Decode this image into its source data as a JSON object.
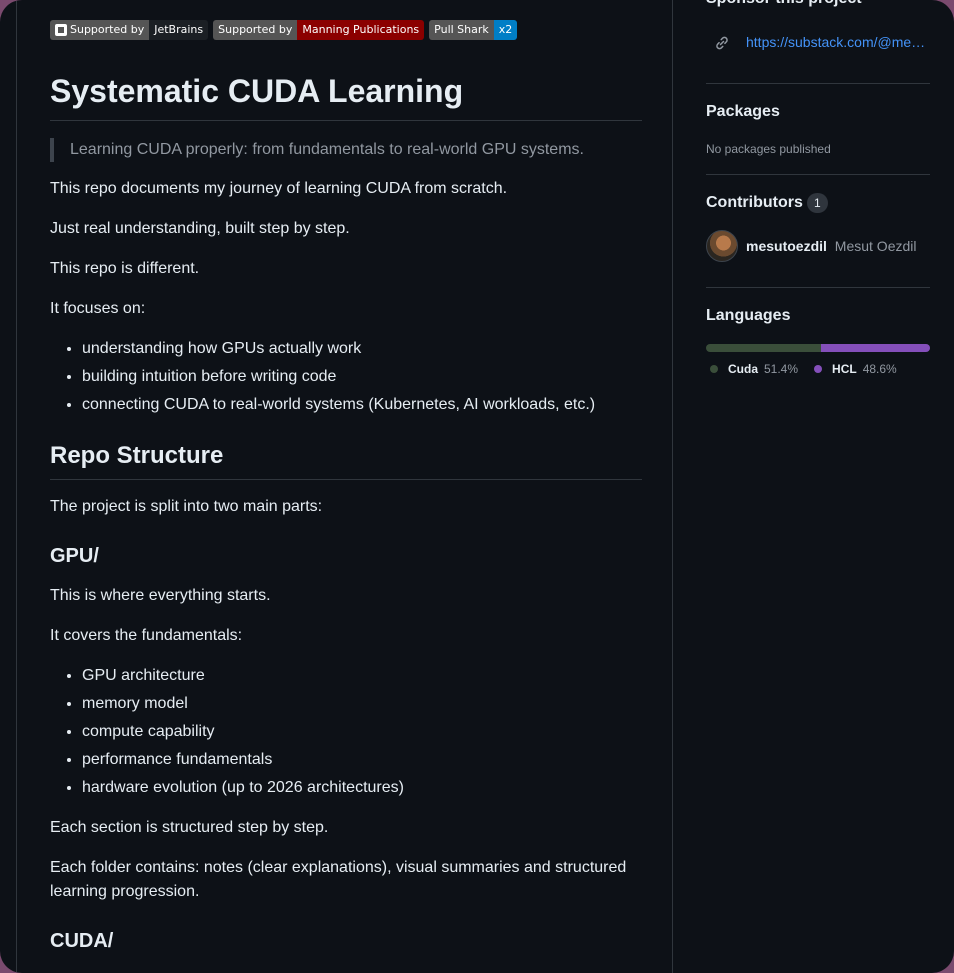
{
  "badges": [
    {
      "label": "Supported by",
      "value": "JetBrains",
      "icon": "jetbrains-icon"
    },
    {
      "label": "Supported by",
      "value": "Manning Publications"
    },
    {
      "label": "Pull Shark",
      "value": "x2"
    }
  ],
  "readme": {
    "title": "Systematic CUDA Learning",
    "quote": "Learning CUDA properly: from fundamentals to real-world GPU systems.",
    "p1": "This repo documents my journey of learning CUDA from scratch.",
    "p2": "Just real understanding, built step by step.",
    "p3": "This repo is different.",
    "p4": "It focuses on:",
    "focus": [
      "understanding how GPUs actually work",
      "building intuition before writing code",
      "connecting CUDA to real-world systems (Kubernetes, AI workloads, etc.)"
    ],
    "h_structure": "Repo Structure",
    "p5": "The project is split into two main parts:",
    "h_gpu": "GPU/",
    "p6": "This is where everything starts.",
    "p7": "It covers the fundamentals:",
    "fundamentals": [
      "GPU architecture",
      "memory model",
      "compute capability",
      "performance fundamentals",
      "hardware evolution (up to 2026 architectures)"
    ],
    "p8": "Each section is structured step by step.",
    "p9": "Each folder contains: notes (clear explanations), visual summaries and structured learning progression.",
    "h_cuda": "CUDA/"
  },
  "sidebar": {
    "sponsor_title": "Sponsor this project",
    "sponsor_link": "https://substack.com/@mesutoezdil",
    "packages_title": "Packages",
    "packages_text": "No packages published",
    "contributors_title": "Contributors",
    "contributors_count": "1",
    "contributor_login": "mesutoezdil",
    "contributor_name": "Mesut Oezdil",
    "languages_title": "Languages",
    "languages": [
      {
        "name": "Cuda",
        "percent": "51.4%",
        "value": 51.4,
        "color": "#3a4e3a"
      },
      {
        "name": "HCL",
        "percent": "48.6%",
        "value": 48.6,
        "color": "#844fba"
      }
    ]
  }
}
